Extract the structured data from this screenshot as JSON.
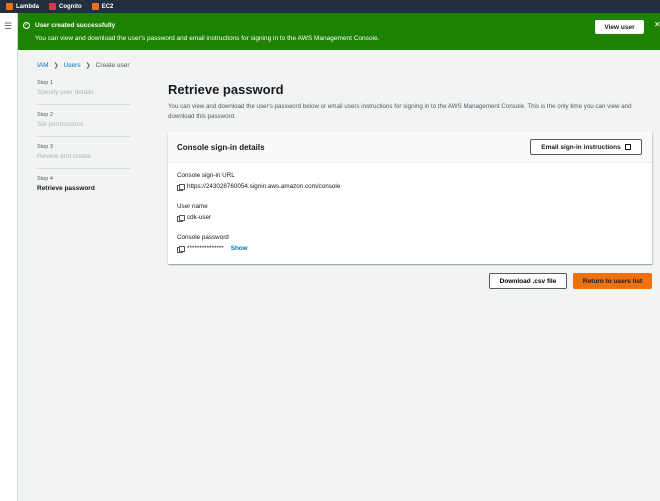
{
  "topbar": {
    "services": [
      {
        "label": "Lambda",
        "icon": "lambda-icon",
        "color": "#ec7211"
      },
      {
        "label": "Cognito",
        "icon": "cognito-icon",
        "color": "#dd344c"
      },
      {
        "label": "EC2",
        "icon": "ec2-icon",
        "color": "#ec7211"
      }
    ]
  },
  "flash": {
    "title": "User created successfully",
    "message": "You can view and download the user's password and email instructions for signing in to the AWS Management Console.",
    "button": "View user",
    "close": "✕",
    "color": "#1d8102"
  },
  "breadcrumb": {
    "items": [
      "IAM",
      "Users",
      "Create user"
    ],
    "separator": "❯"
  },
  "steps": [
    {
      "num": "Step 1",
      "name": "Specify user details"
    },
    {
      "num": "Step 2",
      "name": "Set permissions"
    },
    {
      "num": "Step 3",
      "name": "Review and create"
    },
    {
      "num": "Step 4",
      "name": "Retrieve password"
    }
  ],
  "main": {
    "title": "Retrieve password",
    "description": "You can view and download the user's password below or email users instructions for signing in to the AWS Management Console. This is the only time you can view and download this password."
  },
  "card": {
    "title": "Console sign-in details",
    "email_button": "Email sign-in instructions",
    "url_label": "Console sign-in URL",
    "url_value": "https://243028760054.signin.aws.amazon.com/console",
    "username_label": "User name",
    "username_value": "cdk-user",
    "password_label": "Console password",
    "password_value": "***************",
    "show_label": "Show"
  },
  "actions": {
    "download": "Download .csv file",
    "return": "Return to users list",
    "primary_color": "#ec7211"
  }
}
